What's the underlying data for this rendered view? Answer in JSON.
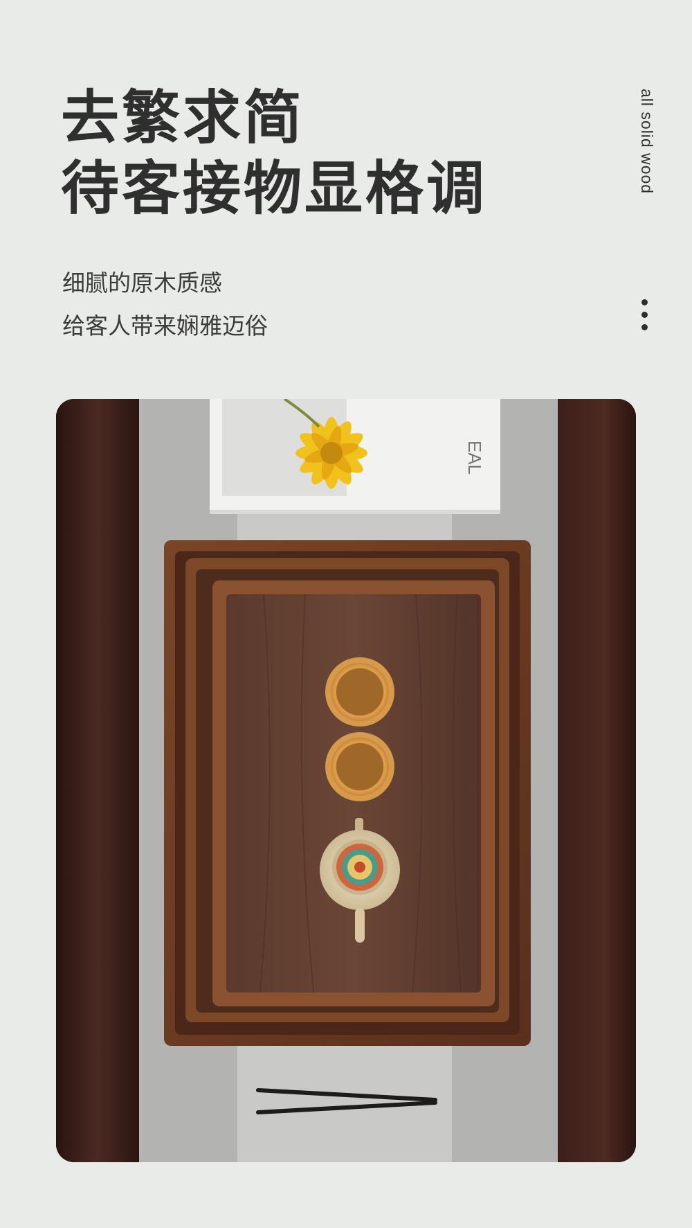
{
  "headline": {
    "line1": "去繁求简",
    "line2": "待客接物显格调"
  },
  "subtitle": {
    "line1": "细腻的原木质感",
    "line2": "给客人带来娴雅迈俗"
  },
  "side_text": "all solid wood",
  "photo": {
    "book_text": "EAL",
    "colors": {
      "dark_wood": "#3a1e18",
      "linen": "#b8b9b6",
      "tray": "#6a3b22",
      "tray_inner": "#5d3a2c",
      "cup": "#c98a3d",
      "sunflower": "#f1c21b"
    }
  }
}
